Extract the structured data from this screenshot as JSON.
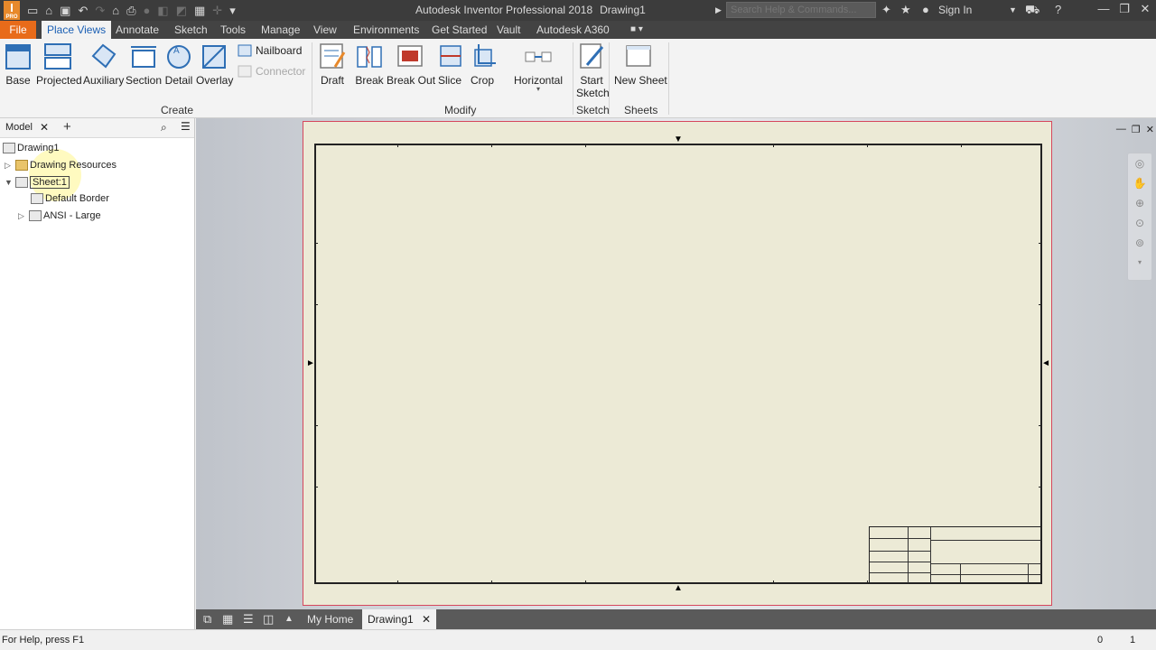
{
  "titlebar": {
    "app_title": "Autodesk Inventor Professional 2018",
    "doc_title": "Drawing1",
    "search_placeholder": "Search Help & Commands...",
    "signin_label": "Sign In",
    "logo_letter": "I",
    "logo_sub": "PRO"
  },
  "ribbon_tabs": [
    {
      "label": "File"
    },
    {
      "label": "Place Views"
    },
    {
      "label": "Annotate"
    },
    {
      "label": "Sketch"
    },
    {
      "label": "Tools"
    },
    {
      "label": "Manage"
    },
    {
      "label": "View"
    },
    {
      "label": "Environments"
    },
    {
      "label": "Get Started"
    },
    {
      "label": "Vault"
    },
    {
      "label": "Autodesk A360"
    }
  ],
  "ribbon": {
    "create": {
      "label": "Create",
      "buttons": [
        "Base",
        "Projected",
        "Auxiliary",
        "Section",
        "Detail",
        "Overlay"
      ],
      "small": [
        "Nailboard",
        "Connector"
      ]
    },
    "modify": {
      "label": "Modify",
      "buttons": [
        "Draft",
        "Break",
        "Break Out",
        "Slice",
        "Crop",
        "Horizontal"
      ]
    },
    "sketch": {
      "label": "Sketch",
      "button_line1": "Start",
      "button_line2": "Sketch"
    },
    "sheets": {
      "label": "Sheets",
      "button": "New Sheet"
    }
  },
  "browser": {
    "tab_label": "Model",
    "tree": {
      "root": "Drawing1",
      "resources": "Drawing Resources",
      "sheet": "Sheet:1",
      "border": "Default Border",
      "title_block": "ANSI - Large"
    }
  },
  "doc_tabs": {
    "home": "My Home",
    "drawing": "Drawing1"
  },
  "status": {
    "help": "For Help, press F1",
    "count_a": "0",
    "count_b": "1"
  },
  "colors": {
    "accent_orange": "#e86b1a",
    "sheet_paper": "#ecead6",
    "sheet_outline": "#d6475d"
  }
}
